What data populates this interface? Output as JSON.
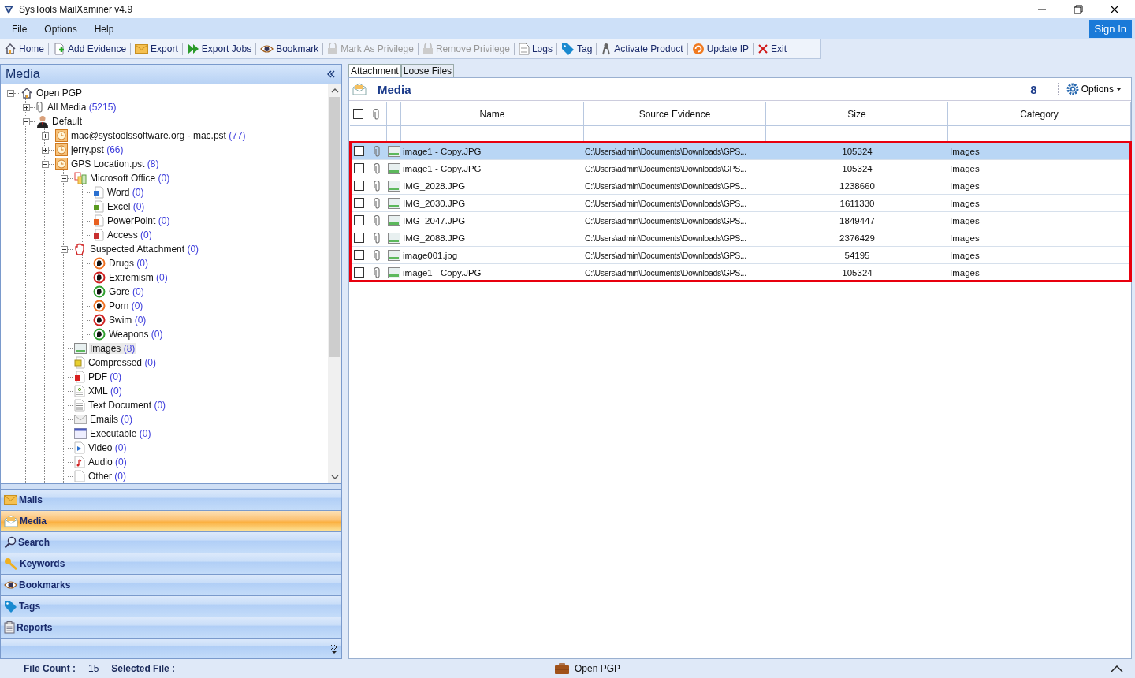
{
  "window": {
    "title": "SysTools MailXaminer v4.9"
  },
  "menu": [
    "File",
    "Options",
    "Help"
  ],
  "sign_in": "Sign In",
  "toolbar": [
    {
      "label": "Home",
      "kind": "home",
      "disabled": false
    },
    {
      "label": "Add Evidence",
      "kind": "add",
      "disabled": false
    },
    {
      "label": "Export",
      "kind": "envelope",
      "disabled": false
    },
    {
      "label": "Export Jobs",
      "kind": "play",
      "disabled": false
    },
    {
      "label": "Bookmark",
      "kind": "eye",
      "disabled": false
    },
    {
      "label": "Mark As Privilege",
      "kind": "lock",
      "disabled": true
    },
    {
      "label": "Remove Privilege",
      "kind": "lock",
      "disabled": true
    },
    {
      "label": "Logs",
      "kind": "doc",
      "disabled": false
    },
    {
      "label": "Tag",
      "kind": "tag",
      "disabled": false
    },
    {
      "label": "Activate Product",
      "kind": "person",
      "disabled": false
    },
    {
      "label": "Update IP",
      "kind": "refresh",
      "disabled": false
    },
    {
      "label": "Exit",
      "kind": "x",
      "disabled": false
    }
  ],
  "left_panel": {
    "title": "Media",
    "tree": [
      {
        "label": "Open PGP",
        "kind": "home",
        "expanded": true,
        "selected": false,
        "children": [
          {
            "label": "All Media",
            "count": "(5215)",
            "kind": "clip",
            "expanded": false,
            "selected": false
          },
          {
            "label": "Default",
            "kind": "user",
            "expanded": true,
            "selected": false,
            "children": [
              {
                "label": "mac@systoolssoftware.org - mac.pst",
                "count": "(77)",
                "kind": "pst",
                "expanded": false,
                "selected": false
              },
              {
                "label": "jerry.pst",
                "count": "(66)",
                "kind": "pst",
                "expanded": false,
                "selected": false
              },
              {
                "label": "GPS Location.pst",
                "count": "(8)",
                "kind": "pst",
                "expanded": true,
                "selected": false,
                "children": [
                  {
                    "label": "Microsoft Office",
                    "count": "(0)",
                    "kind": "office",
                    "expanded": true,
                    "selected": false,
                    "children": [
                      {
                        "label": "Word",
                        "count": "(0)",
                        "kind": "word",
                        "selected": false
                      },
                      {
                        "label": "Excel",
                        "count": "(0)",
                        "kind": "excel",
                        "selected": false
                      },
                      {
                        "label": "PowerPoint",
                        "count": "(0)",
                        "kind": "ppt",
                        "selected": false
                      },
                      {
                        "label": "Access",
                        "count": "(0)",
                        "kind": "access",
                        "selected": false
                      }
                    ]
                  },
                  {
                    "label": "Suspected Attachment",
                    "count": "(0)",
                    "kind": "hand",
                    "expanded": true,
                    "selected": false,
                    "children": [
                      {
                        "label": "Drugs",
                        "count": "(0)",
                        "kind": "ban",
                        "color": "#f07020",
                        "selected": false
                      },
                      {
                        "label": "Extremism",
                        "count": "(0)",
                        "kind": "ban",
                        "color": "#d02020",
                        "selected": false
                      },
                      {
                        "label": "Gore",
                        "count": "(0)",
                        "kind": "ban",
                        "color": "#30a030",
                        "selected": false
                      },
                      {
                        "label": "Porn",
                        "count": "(0)",
                        "kind": "ban",
                        "color": "#f07020",
                        "selected": false
                      },
                      {
                        "label": "Swim",
                        "count": "(0)",
                        "kind": "ban",
                        "color": "#d02020",
                        "selected": false
                      },
                      {
                        "label": "Weapons",
                        "count": "(0)",
                        "kind": "ban",
                        "color": "#30a030",
                        "selected": false
                      }
                    ]
                  },
                  {
                    "label": "Images",
                    "count": "(8)",
                    "kind": "image",
                    "selected": true
                  },
                  {
                    "label": "Compressed",
                    "count": "(0)",
                    "kind": "zip",
                    "selected": false
                  },
                  {
                    "label": "PDF",
                    "count": "(0)",
                    "kind": "pdf",
                    "selected": false
                  },
                  {
                    "label": "XML",
                    "count": "(0)",
                    "kind": "xml",
                    "selected": false
                  },
                  {
                    "label": "Text Document",
                    "count": "(0)",
                    "kind": "text",
                    "selected": false
                  },
                  {
                    "label": "Emails",
                    "count": "(0)",
                    "kind": "mail",
                    "selected": false
                  },
                  {
                    "label": "Executable",
                    "count": "(0)",
                    "kind": "exe",
                    "selected": false
                  },
                  {
                    "label": "Video",
                    "count": "(0)",
                    "kind": "video",
                    "selected": false
                  },
                  {
                    "label": "Audio",
                    "count": "(0)",
                    "kind": "audio",
                    "selected": false
                  },
                  {
                    "label": "Other",
                    "count": "(0)",
                    "kind": "file",
                    "selected": false
                  }
                ]
              }
            ]
          }
        ]
      }
    ]
  },
  "nav": [
    {
      "label": "Mails",
      "kind": "envelope",
      "selected": false
    },
    {
      "label": "Media",
      "kind": "media",
      "selected": true
    },
    {
      "label": "Search",
      "kind": "search",
      "selected": false
    },
    {
      "label": "Keywords",
      "kind": "key",
      "selected": false
    },
    {
      "label": "Bookmarks",
      "kind": "eye",
      "selected": false
    },
    {
      "label": "Tags",
      "kind": "tag",
      "selected": false
    },
    {
      "label": "Reports",
      "kind": "clipboard",
      "selected": false
    }
  ],
  "status": {
    "file_count_label": "File Count :",
    "file_count": "15",
    "selected_file_label": "Selected File :",
    "center": "Open PGP"
  },
  "tabs": [
    {
      "label": "Attachment",
      "selected": true
    },
    {
      "label": "Loose Files",
      "selected": false
    }
  ],
  "media_panel": {
    "title": "Media",
    "count": "8",
    "options": "Options"
  },
  "table": {
    "columns": [
      "Name",
      "Source Evidence",
      "Size",
      "Category"
    ],
    "highlighted": true,
    "header_checked": false,
    "rows": [
      {
        "name": "image1 - Copy.JPG",
        "source": "C:\\Users\\admin\\Documents\\Downloads\\GPS...",
        "size": "105324",
        "category": "Images",
        "checked": false,
        "selected": true
      },
      {
        "name": "image1 - Copy.JPG",
        "source": "C:\\Users\\admin\\Documents\\Downloads\\GPS...",
        "size": "105324",
        "category": "Images",
        "checked": false,
        "selected": false
      },
      {
        "name": "IMG_2028.JPG",
        "source": "C:\\Users\\admin\\Documents\\Downloads\\GPS...",
        "size": "1238660",
        "category": "Images",
        "checked": false,
        "selected": false
      },
      {
        "name": "IMG_2030.JPG",
        "source": "C:\\Users\\admin\\Documents\\Downloads\\GPS...",
        "size": "1611330",
        "category": "Images",
        "checked": false,
        "selected": false
      },
      {
        "name": "IMG_2047.JPG",
        "source": "C:\\Users\\admin\\Documents\\Downloads\\GPS...",
        "size": "1849447",
        "category": "Images",
        "checked": false,
        "selected": false
      },
      {
        "name": "IMG_2088.JPG",
        "source": "C:\\Users\\admin\\Documents\\Downloads\\GPS...",
        "size": "2376429",
        "category": "Images",
        "checked": false,
        "selected": false
      },
      {
        "name": "image001.jpg",
        "source": "C:\\Users\\admin\\Documents\\Downloads\\GPS...",
        "size": "54195",
        "category": "Images",
        "checked": false,
        "selected": false
      },
      {
        "name": "image1 - Copy.JPG",
        "source": "C:\\Users\\admin\\Documents\\Downloads\\GPS...",
        "size": "105324",
        "category": "Images",
        "checked": false,
        "selected": false
      }
    ]
  }
}
